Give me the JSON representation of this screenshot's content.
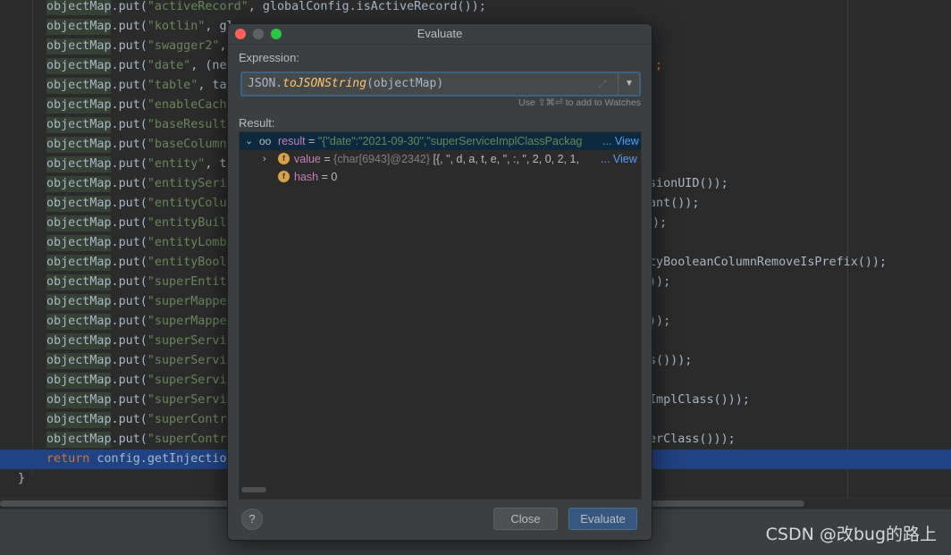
{
  "editor": {
    "lines": [
      {
        "pre": "objectMap.put(",
        "str": "\"activeRecord\"",
        "post": ", globalConfig.isActiveRecord());",
        "tail": ""
      },
      {
        "pre": "objectMap.put(",
        "str": "\"kotlin\"",
        "post": ", gl",
        "tail": ""
      },
      {
        "pre": "objectMap.put(",
        "str": "\"swagger2\"",
        "post": ",",
        "tail": ""
      },
      {
        "pre": "objectMap.put(",
        "str": "\"date\"",
        "post": ", (ne",
        "tail": ";"
      },
      {
        "pre": "objectMap.put(",
        "str": "\"table\"",
        "post": ", ta",
        "tail": ""
      },
      {
        "pre": "objectMap.put(",
        "str": "\"enableCach",
        "post": "",
        "tail": ""
      },
      {
        "pre": "objectMap.put(",
        "str": "\"baseResult",
        "post": "",
        "tail": ""
      },
      {
        "pre": "objectMap.put(",
        "str": "\"baseColumn",
        "post": "",
        "tail": ""
      },
      {
        "pre": "objectMap.put(",
        "str": "\"entity\"",
        "post": ", t",
        "tail": ""
      },
      {
        "pre": "objectMap.put(",
        "str": "\"entitySeri",
        "post": "",
        "tail": "sionUID());"
      },
      {
        "pre": "objectMap.put(",
        "str": "\"entityColu",
        "post": "",
        "tail": "ant());"
      },
      {
        "pre": "objectMap.put(",
        "str": "\"entityBuil",
        "post": "",
        "tail": ");"
      },
      {
        "pre": "objectMap.put(",
        "str": "\"entityLomb",
        "post": "",
        "tail": ""
      },
      {
        "pre": "objectMap.put(",
        "str": "\"entityBool",
        "post": "",
        "tail": "tyBooleanColumnRemoveIsPrefix());"
      },
      {
        "pre": "objectMap.put(",
        "str": "\"superEntit",
        "post": "",
        "tail": "));"
      },
      {
        "pre": "objectMap.put(",
        "str": "\"superMappe",
        "post": "",
        "tail": ""
      },
      {
        "pre": "objectMap.put(",
        "str": "\"superMappe",
        "post": "",
        "tail": "));"
      },
      {
        "pre": "objectMap.put(",
        "str": "\"superServi",
        "post": "",
        "tail": ""
      },
      {
        "pre": "objectMap.put(",
        "str": "\"superServi",
        "post": "",
        "tail": "s()));"
      },
      {
        "pre": "objectMap.put(",
        "str": "\"superServi",
        "post": "",
        "tail": ""
      },
      {
        "pre": "objectMap.put(",
        "str": "\"superServi",
        "post": "",
        "tail": "ImplClass()));"
      },
      {
        "pre": "objectMap.put(",
        "str": "\"superContr",
        "post": "",
        "tail": ""
      },
      {
        "pre": "objectMap.put(",
        "str": "\"superContr",
        "post": "",
        "tail": "erClass()));"
      }
    ],
    "return_line": {
      "kw": "return",
      "rest": " config.getInjectio"
    },
    "closing_brace": "}"
  },
  "dialog": {
    "title": "Evaluate",
    "expression_label": "Expression:",
    "expression": {
      "obj": "JSON.",
      "method": "toJSONString",
      "args": "(objectMap)"
    },
    "watch_hint": "Use ⇧⌘⏎ to add to Watches",
    "result_label": "Result:",
    "result": {
      "name": "result",
      "eq": " = ",
      "value": "\"{\"date\":\"2021-09-30\",\"superServiceImplClassPackag",
      "view": "... View",
      "children": [
        {
          "name": "value",
          "eq": " = ",
          "type": "{char[6943]@2342}",
          "value": " [{, \", d, a, t, e, \", :, \", 2, 0, 2, 1,",
          "view": "... View"
        },
        {
          "name": "hash",
          "eq": " = ",
          "value": "0"
        }
      ]
    },
    "buttons": {
      "help": "?",
      "close": "Close",
      "evaluate": "Evaluate"
    }
  },
  "watermark": "CSDN @改bug的路上",
  "colors": {
    "accent": "#365880",
    "selection": "#214283",
    "string": "#6a8759",
    "keyword": "#cc7832"
  },
  "icons": [
    "expand-icon",
    "dropdown-icon",
    "chevron-down-icon",
    "chevron-right-icon",
    "watch-glasses-icon",
    "field-icon",
    "help-icon"
  ]
}
